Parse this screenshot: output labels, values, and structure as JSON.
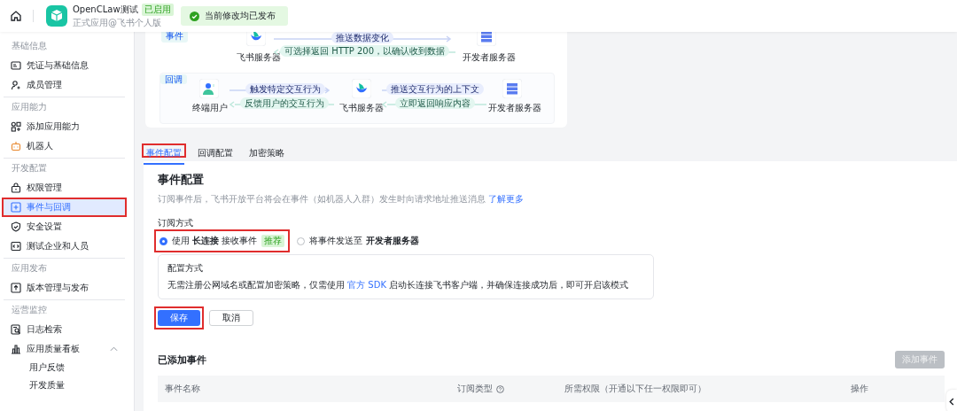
{
  "header": {
    "app_name": "OpenCLaw测试",
    "status_tag": "已启用",
    "subtitle": "正式应用@飞书个人版",
    "toast": "当前修改均已发布"
  },
  "sidebar": {
    "sections": [
      {
        "title": "基础信息",
        "items": [
          {
            "label": "凭证与基础信息",
            "selected": false,
            "highlighted": false
          },
          {
            "label": "成员管理",
            "selected": false,
            "highlighted": false
          }
        ]
      },
      {
        "title": "应用能力",
        "items": [
          {
            "label": "添加应用能力",
            "selected": false,
            "highlighted": false
          },
          {
            "label": "机器人",
            "selected": false,
            "highlighted": false
          }
        ]
      },
      {
        "title": "开发配置",
        "items": [
          {
            "label": "权限管理",
            "selected": false,
            "highlighted": false
          },
          {
            "label": "事件与回调",
            "selected": true,
            "highlighted": true
          },
          {
            "label": "安全设置",
            "selected": false,
            "highlighted": false
          },
          {
            "label": "测试企业和人员",
            "selected": false,
            "highlighted": false
          }
        ]
      },
      {
        "title": "应用发布",
        "items": [
          {
            "label": "版本管理与发布",
            "selected": false,
            "highlighted": false
          }
        ]
      },
      {
        "title": "运营监控",
        "items": [
          {
            "label": "日志检索",
            "selected": false,
            "highlighted": false
          },
          {
            "label": "应用质量看板",
            "selected": false,
            "highlighted": false,
            "expanded": true,
            "children": [
              {
                "label": "用户反馈",
                "selected": false
              },
              {
                "label": "开发质量",
                "selected": false
              }
            ]
          }
        ]
      }
    ]
  },
  "diagram": {
    "event": {
      "tag": "事件",
      "left": "飞书服务器",
      "right": "开发者服务器",
      "forward": "推送数据变化",
      "back": "可选择返回 HTTP 200，以确认收到数据"
    },
    "callback": {
      "tag": "回调",
      "user": "终端用户",
      "middle": "飞书服务器",
      "right": "开发者服务器",
      "forward_1": "触发特定交互行为",
      "back_1": "反馈用户的交互行为",
      "forward_2": "推送交互行为的上下文",
      "back_2": "立即返回响应内容"
    }
  },
  "tabs": [
    {
      "label": "事件配置",
      "selected": true,
      "highlighted": true
    },
    {
      "label": "回调配置",
      "selected": false,
      "highlighted": false
    },
    {
      "label": "加密策略",
      "selected": false,
      "highlighted": false
    }
  ],
  "config": {
    "title": "事件配置",
    "description": "订阅事件后，飞书开放平台将会在事件（如机器人入群）发生时向请求地址推送消息",
    "description_link": "了解更多",
    "subscribe_label": "订阅方式",
    "options": [
      {
        "label": "使用 **长连接** 接收事件",
        "badge": "推荐",
        "selected": true,
        "highlighted": true
      },
      {
        "label": "将事件发送至 **开发者服务器**",
        "selected": false,
        "highlighted": false
      }
    ],
    "info": {
      "title": "配置方式",
      "text_before": "无需注册公网域名或配置加密策略，仅需使用",
      "link": "官方 SDK",
      "text_after": "启动长连接飞书客户端，并确保连接成功后，即可开启该模式"
    },
    "buttons": [
      {
        "kind": "primary",
        "label": "保存",
        "highlighted": true
      },
      {
        "kind": "default",
        "label": "取消",
        "highlighted": false
      }
    ]
  },
  "events": {
    "title": "已添加事件",
    "add_button": {
      "label": "添加事件",
      "disabled": true
    },
    "columns": [
      {
        "label": "事件名称",
        "help": false
      },
      {
        "label": "订阅类型",
        "help": true
      },
      {
        "label": "所需权限（开通以下任一权限即可）",
        "help": false
      },
      {
        "label": "操作",
        "help": false
      }
    ]
  }
}
